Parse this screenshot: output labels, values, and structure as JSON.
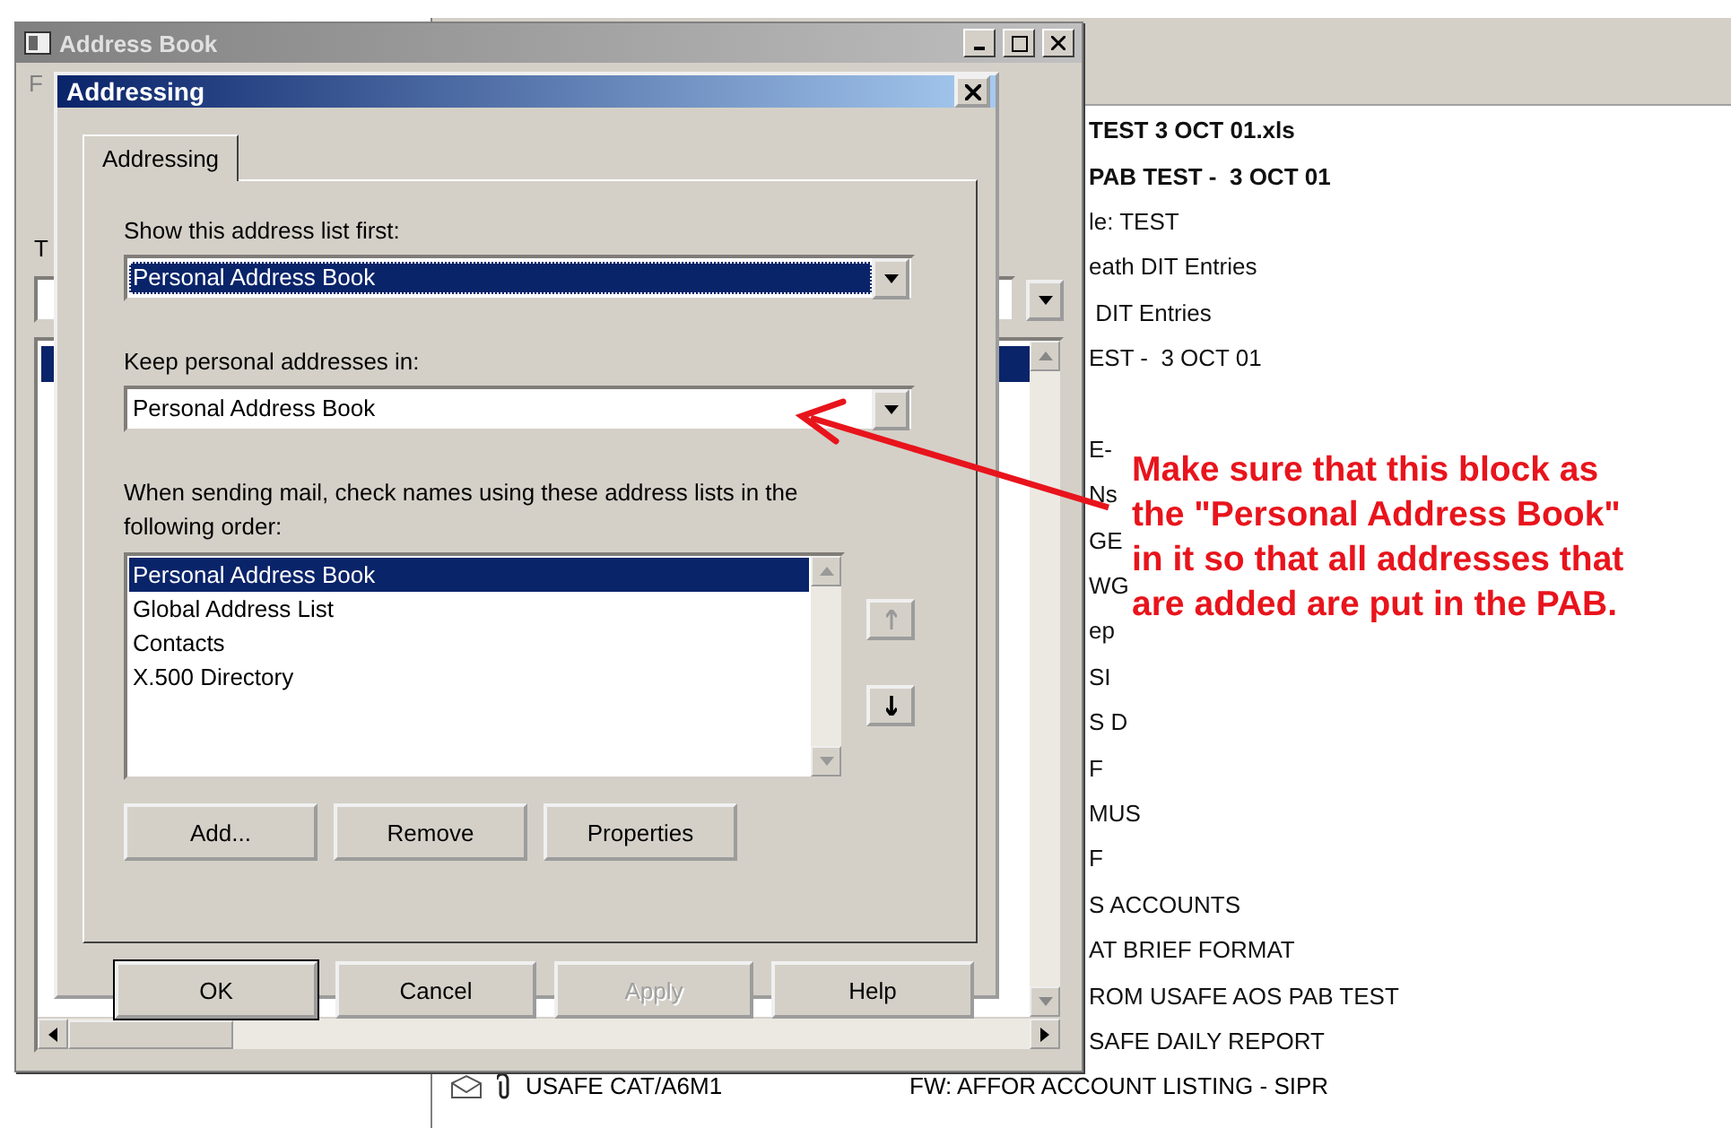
{
  "address_book": {
    "title": "Address Book",
    "menu_fragment": "F",
    "label_fragment": "T"
  },
  "dialog": {
    "title": "Addressing",
    "tabs": [
      {
        "label": "Addressing",
        "selected": true
      }
    ],
    "show_first": {
      "label": "Show this address list first:",
      "value": "Personal Address Book",
      "focused": true
    },
    "keep_in": {
      "label": "Keep personal addresses in:",
      "value": "Personal Address Book",
      "focused": false
    },
    "order_label": "When sending mail, check names using these address lists in the following order:",
    "order_list": [
      {
        "label": "Personal Address Book",
        "selected": true
      },
      {
        "label": "Global Address List",
        "selected": false
      },
      {
        "label": "Contacts",
        "selected": false
      },
      {
        "label": "X.500 Directory",
        "selected": false
      }
    ],
    "move_buttons": [
      {
        "kind": "up",
        "disabled": true
      },
      {
        "kind": "down",
        "disabled": false
      }
    ],
    "list_buttons": [
      "Add...",
      "Remove",
      "Properties"
    ],
    "buttons": [
      {
        "label": "OK",
        "default": true,
        "disabled": false
      },
      {
        "label": "Cancel",
        "default": false,
        "disabled": false
      },
      {
        "label": "Apply",
        "default": false,
        "disabled": true
      },
      {
        "label": "Help",
        "default": false,
        "disabled": false
      }
    ]
  },
  "messages": [
    {
      "kind": "text",
      "text": "TEST 3 OCT 01.xls",
      "bold": true
    },
    {
      "kind": "text",
      "text": "PAB TEST -  3 OCT 01",
      "bold": true
    },
    {
      "kind": "text",
      "text": "le: TEST",
      "bold": false
    },
    {
      "kind": "text",
      "text": "eath DIT Entries",
      "bold": false
    },
    {
      "kind": "text",
      "text": " DIT Entries",
      "bold": false
    },
    {
      "kind": "text",
      "text": "EST -  3 OCT 01",
      "bold": false
    },
    {
      "kind": "empty"
    },
    {
      "kind": "text",
      "text": "E-",
      "bold": false
    },
    {
      "kind": "text",
      "text": "Ns",
      "bold": false
    },
    {
      "kind": "text",
      "text": "GE",
      "bold": false
    },
    {
      "kind": "text",
      "text": "WG",
      "bold": false
    },
    {
      "kind": "text",
      "text": "ep",
      "bold": false
    },
    {
      "kind": "text",
      "text": "SI",
      "bold": false
    },
    {
      "kind": "text",
      "text": "S D",
      "bold": false
    },
    {
      "kind": "text",
      "text": "F",
      "bold": false
    },
    {
      "kind": "text",
      "text": "MUS",
      "bold": false
    },
    {
      "kind": "text",
      "text": "F",
      "bold": false
    },
    {
      "kind": "text",
      "text": "S ACCOUNTS",
      "bold": false
    },
    {
      "kind": "text",
      "text": "AT BRIEF FORMAT",
      "bold": false
    },
    {
      "kind": "text",
      "text": "ROM USAFE AOS PAB TEST",
      "bold": false
    },
    {
      "kind": "text",
      "text": "SAFE DAILY REPORT",
      "bold": false
    }
  ],
  "bottom_message": {
    "from": "USAFE CAT/A6M1",
    "subject": "FW: AFFOR ACCOUNT LISTING - SIPR",
    "attachment": true
  },
  "annotation": {
    "lines": [
      "Make sure that this block as",
      "the \"Personal Address Book\"",
      "in it so that all addresses that",
      "are added are put in the PAB."
    ]
  }
}
